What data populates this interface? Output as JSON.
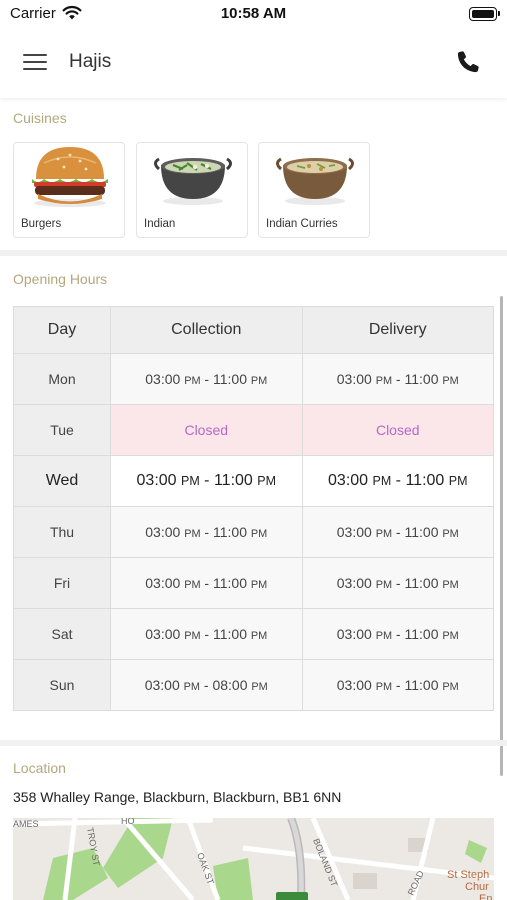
{
  "status_bar": {
    "carrier": "Carrier",
    "time": "10:58 AM"
  },
  "header": {
    "title": "Hajis"
  },
  "cuisines": {
    "label": "Cuisines",
    "items": [
      {
        "name": "Burgers"
      },
      {
        "name": "Indian"
      },
      {
        "name": "Indian Curries"
      }
    ]
  },
  "opening_hours": {
    "label": "Opening Hours",
    "columns": [
      "Day",
      "Collection",
      "Delivery"
    ],
    "rows": [
      {
        "day": "Mon",
        "collection": {
          "open": "03:00",
          "open_ampm": "PM",
          "sep": " - ",
          "close": "11:00",
          "close_ampm": "PM"
        },
        "delivery": {
          "open": "03:00",
          "open_ampm": "PM",
          "sep": " - ",
          "close": "11:00",
          "close_ampm": "PM"
        }
      },
      {
        "day": "Tue",
        "closed_text": "Closed"
      },
      {
        "day": "Wed",
        "collection": {
          "open": "03:00",
          "open_ampm": "PM",
          "sep": " - ",
          "close": "11:00",
          "close_ampm": "PM"
        },
        "delivery": {
          "open": "03:00",
          "open_ampm": "PM",
          "sep": " - ",
          "close": "11:00",
          "close_ampm": "PM"
        }
      },
      {
        "day": "Thu",
        "collection": {
          "open": "03:00",
          "open_ampm": "PM",
          "sep": " - ",
          "close": "11:00",
          "close_ampm": "PM"
        },
        "delivery": {
          "open": "03:00",
          "open_ampm": "PM",
          "sep": " - ",
          "close": "11:00",
          "close_ampm": "PM"
        }
      },
      {
        "day": "Fri",
        "collection": {
          "open": "03:00",
          "open_ampm": "PM",
          "sep": " - ",
          "close": "11:00",
          "close_ampm": "PM"
        },
        "delivery": {
          "open": "03:00",
          "open_ampm": "PM",
          "sep": " - ",
          "close": "11:00",
          "close_ampm": "PM"
        }
      },
      {
        "day": "Sat",
        "collection": {
          "open": "03:00",
          "open_ampm": "PM",
          "sep": " - ",
          "close": "11:00",
          "close_ampm": "PM"
        },
        "delivery": {
          "open": "03:00",
          "open_ampm": "PM",
          "sep": " - ",
          "close": "11:00",
          "close_ampm": "PM"
        }
      },
      {
        "day": "Sun",
        "collection": {
          "open": "03:00",
          "open_ampm": "PM",
          "sep": " - ",
          "close": "08:00",
          "close_ampm": "PM"
        },
        "delivery": {
          "open": "03:00",
          "open_ampm": "PM",
          "sep": " - ",
          "close": "11:00",
          "close_ampm": "PM"
        }
      }
    ]
  },
  "location": {
    "label": "Location",
    "address": "358 Whalley Range, Blackburn, Blackburn, BB1 6NN",
    "map_labels": {
      "street_1": "AMES",
      "street_2": "TROY ST",
      "street_3": "HO",
      "street_4": "OAK ST",
      "street_5": "BOLAND ST",
      "street_6": "ROAD",
      "poi_line_1": "St Steph",
      "poi_line_2": "Chur",
      "poi_line_3": "En"
    }
  },
  "colors": {
    "section_label": "#b4a77e",
    "closed_text": "#b36ac4",
    "closed_bg": "#fbe6ea"
  }
}
